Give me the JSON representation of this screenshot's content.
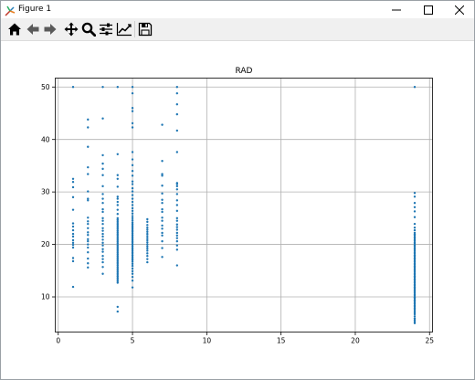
{
  "window": {
    "title": "Figure 1",
    "icons": {
      "app": "matplotlib-icon",
      "minimize": "minimize-icon",
      "maximize": "maximize-icon",
      "close": "close-icon"
    }
  },
  "toolbar": {
    "buttons": [
      {
        "name": "home-button",
        "icon": "home-icon"
      },
      {
        "name": "back-button",
        "icon": "arrow-left-icon"
      },
      {
        "name": "forward-button",
        "icon": "arrow-right-icon"
      },
      {
        "name": "pan-button",
        "icon": "move-icon"
      },
      {
        "name": "zoom-button",
        "icon": "magnifier-icon"
      },
      {
        "name": "subplots-button",
        "icon": "sliders-icon"
      },
      {
        "name": "edit-axis-button",
        "icon": "line-chart-icon"
      },
      {
        "name": "save-button",
        "icon": "floppy-disk-icon"
      }
    ]
  },
  "colors": {
    "marker": "#1f77b4",
    "grid": "#b0b0b0",
    "axes": "#000000",
    "toolbar": "#f0f0f0"
  },
  "chart_data": {
    "type": "scatter",
    "title": "RAD",
    "xlabel": "",
    "ylabel": "",
    "xlim": [
      -0.2,
      25.2
    ],
    "ylim": [
      3.3,
      51.7
    ],
    "xticks": [
      0,
      5,
      10,
      15,
      20,
      25
    ],
    "yticks": [
      10,
      20,
      30,
      40,
      50
    ],
    "grid": true,
    "series": [
      {
        "x_groups": [
          1,
          2,
          3,
          4,
          5,
          6,
          7,
          8,
          24
        ],
        "y_groups": [
          [
            50,
            32.5,
            31.9,
            30.9,
            29.0,
            26.6,
            24.0,
            23.4,
            22.7,
            22.0,
            21.5,
            20.8,
            20.3,
            19.9,
            19.4,
            17.4,
            16.8,
            11.9
          ],
          [
            43.8,
            42.3,
            38.6,
            34.7,
            33.4,
            30.1,
            28.7,
            28.4,
            25.1,
            24.4,
            23.9,
            23.1,
            22.3,
            21.8,
            21.0,
            20.6,
            20.0,
            19.4,
            18.5,
            17.3,
            16.4,
            15.6
          ],
          [
            50,
            44.0,
            37.0,
            35.4,
            34.4,
            33.2,
            31.1,
            29.6,
            28.7,
            27.9,
            26.7,
            26.2,
            25.0,
            24.5,
            23.9,
            23.1,
            22.6,
            22.0,
            21.5,
            20.9,
            20.3,
            19.8,
            19.1,
            18.6,
            17.8,
            17.2,
            16.6,
            15.7,
            14.4
          ],
          [
            50,
            37.2,
            33.2,
            32.5,
            31.0,
            29.1,
            28.7,
            28.1,
            27.5,
            26.6,
            25.8,
            25.0,
            24.7,
            24.4,
            24.1,
            23.8,
            23.5,
            23.2,
            22.9,
            22.6,
            22.3,
            22.0,
            21.7,
            21.4,
            21.1,
            20.8,
            20.5,
            20.2,
            19.9,
            19.6,
            19.3,
            19.0,
            18.7,
            18.4,
            18.1,
            17.8,
            17.5,
            17.2,
            16.9,
            16.6,
            16.3,
            16.0,
            15.7,
            15.4,
            15.1,
            14.8,
            14.5,
            14.2,
            13.9,
            13.6,
            13.3,
            13.0,
            12.7,
            8.1,
            7.2
          ],
          [
            50,
            48.8,
            46.0,
            45.4,
            43.1,
            42.3,
            37.6,
            36.2,
            35.1,
            34.0,
            33.1,
            32.0,
            31.5,
            30.7,
            30.1,
            29.4,
            28.7,
            28.1,
            27.5,
            26.9,
            26.4,
            25.9,
            25.4,
            25.0,
            24.6,
            24.2,
            23.9,
            23.6,
            23.3,
            23.0,
            22.7,
            22.4,
            22.1,
            21.8,
            21.5,
            21.2,
            20.9,
            20.6,
            20.3,
            20.0,
            19.7,
            19.4,
            19.1,
            18.8,
            18.5,
            18.2,
            17.9,
            17.6,
            17.3,
            17.0,
            16.7,
            16.3,
            15.9,
            15.4,
            14.9,
            14.4,
            13.8,
            13.1,
            11.8
          ],
          [
            24.8,
            24.3,
            23.7,
            23.2,
            22.8,
            22.4,
            22.0,
            21.6,
            21.2,
            20.8,
            20.4,
            20.0,
            19.6,
            19.2,
            18.8,
            18.3,
            17.8,
            17.2,
            16.6
          ],
          [
            42.8,
            35.9,
            33.4,
            33.1,
            31.2,
            29.7,
            28.5,
            27.9,
            26.7,
            26.2,
            25.1,
            24.5,
            23.6,
            23.0,
            22.2,
            21.7,
            20.6,
            19.3,
            17.6
          ],
          [
            50,
            48.8,
            46.7,
            44.8,
            41.7,
            37.6,
            31.7,
            31.5,
            31.1,
            30.5,
            29.6,
            28.4,
            27.5,
            26.4,
            25.0,
            24.5,
            23.8,
            23.3,
            22.8,
            22.2,
            21.7,
            21.2,
            20.6,
            19.8,
            19.0,
            16.0
          ],
          [
            50,
            29.8,
            29.1,
            27.9,
            27.1,
            26.3,
            25.2,
            23.9,
            23.2,
            22.7,
            22.2,
            21.9,
            21.7,
            21.4,
            21.2,
            20.9,
            20.7,
            20.4,
            20.2,
            19.9,
            19.7,
            19.4,
            19.2,
            18.9,
            18.7,
            18.4,
            18.2,
            17.9,
            17.7,
            17.4,
            17.2,
            16.9,
            16.7,
            16.4,
            16.2,
            15.9,
            15.7,
            15.4,
            15.2,
            14.9,
            14.7,
            14.4,
            14.2,
            13.9,
            13.7,
            13.4,
            13.2,
            12.9,
            12.7,
            12.4,
            12.2,
            11.9,
            11.7,
            11.4,
            11.2,
            10.9,
            10.7,
            10.4,
            10.2,
            9.9,
            9.7,
            9.4,
            9.2,
            8.9,
            8.7,
            8.4,
            8.2,
            7.9,
            7.6,
            7.3,
            7.0,
            6.7,
            6.3,
            5.9,
            5.6,
            5.3,
            5.0
          ]
        ]
      }
    ]
  }
}
